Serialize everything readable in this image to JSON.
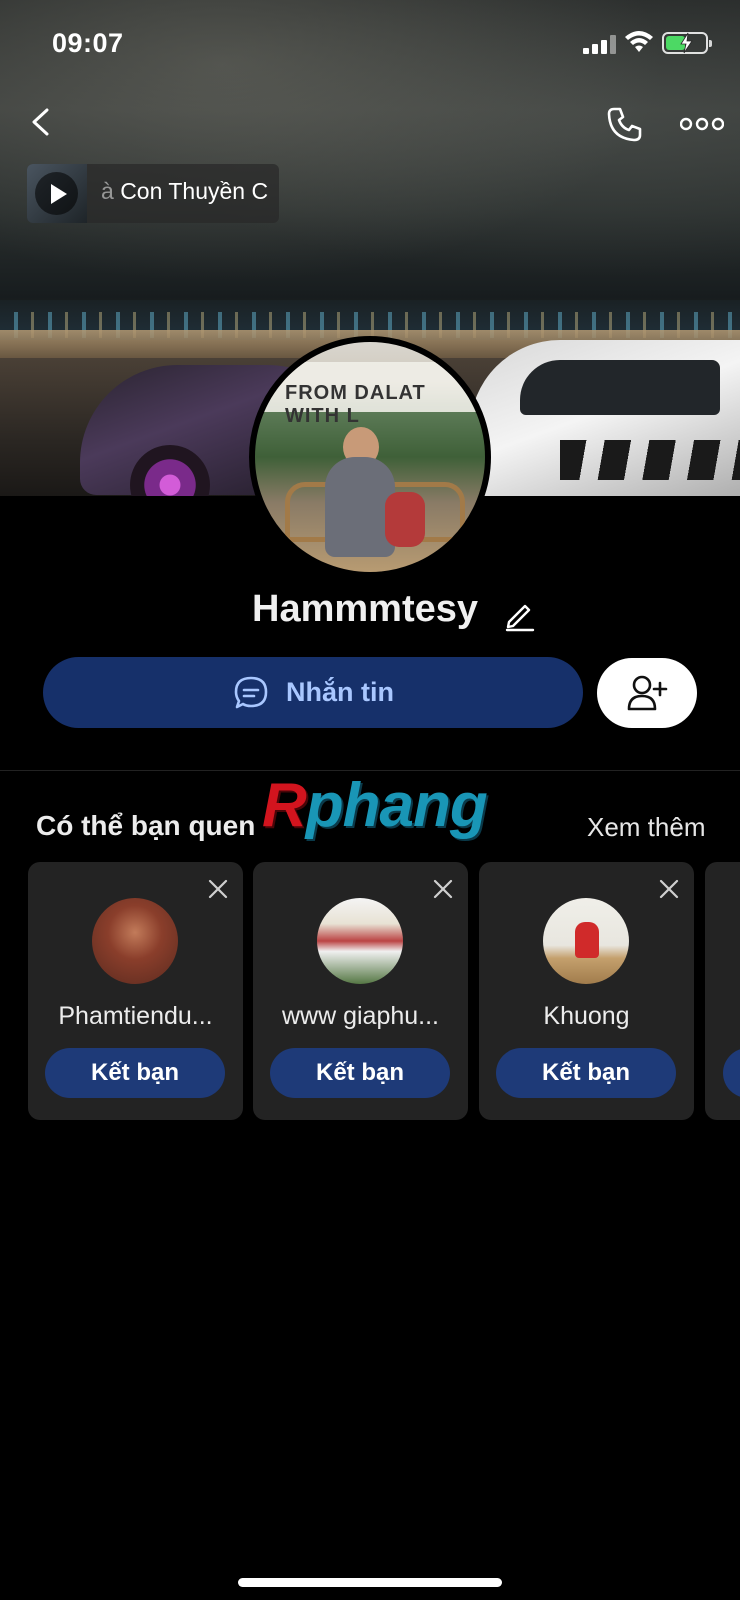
{
  "status_bar": {
    "time": "09:07",
    "battery_level": 0.5,
    "battery_color": "#4cd964"
  },
  "header": {
    "back_icon": "chevron-left-icon",
    "call_icon": "phone-icon",
    "more_icon": "more-horizontal-icon"
  },
  "music": {
    "title_prefix": "à",
    "title": "Con Thuyền C"
  },
  "profile": {
    "name": "Hammmtesy",
    "avatar_sign_text": "FROM DALAT WITH L"
  },
  "actions": {
    "message_label": "Nhắn tin",
    "message_bg": "#16306a",
    "message_text_color": "#a9c7ff"
  },
  "watermark": {
    "first_letter": "R",
    "rest": "phang"
  },
  "suggestions": {
    "title": "Có thể bạn quen",
    "see_more": "Xem thêm",
    "items": [
      {
        "name": "Phamtiendu...",
        "button": "Kết bạn"
      },
      {
        "name": "www giaphu...",
        "button": "Kết bạn"
      },
      {
        "name": "Khuong",
        "button": "Kết bạn"
      }
    ]
  }
}
